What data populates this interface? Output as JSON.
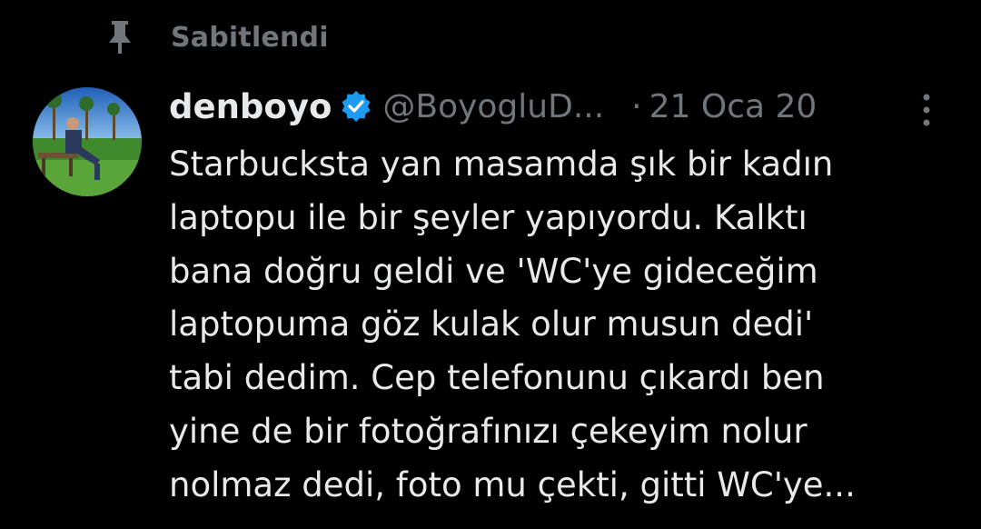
{
  "pinned": {
    "icon": "pin-icon",
    "label": "Sabitlendi"
  },
  "tweet": {
    "avatar_icon": "profile-photo",
    "display_name": "denboyo",
    "verified_icon": "verified-badge-icon",
    "handle": "@BoyogluD...",
    "separator": "·",
    "timestamp": "21 Oca 20",
    "more_icon": "more-options-icon",
    "text": "Starbucksta yan masamda şık bir kadın\nlaptopu ile bir şeyler yapıyordu. Kalktı\nbana doğru geldi ve 'WC'ye gideceğim\nlaptopuma göz kulak olur musun dedi'\ntabi dedim. Cep telefonunu çıkardı ben\nyine de bir fotoğrafınızı çekeyim nolur\nnolmaz dedi, foto mu çekti, gitti WC'ye..."
  },
  "colors": {
    "background": "#000000",
    "primary_text": "#e7e9ea",
    "secondary_text": "#71767b",
    "verified_blue": "#1d9bf0"
  }
}
